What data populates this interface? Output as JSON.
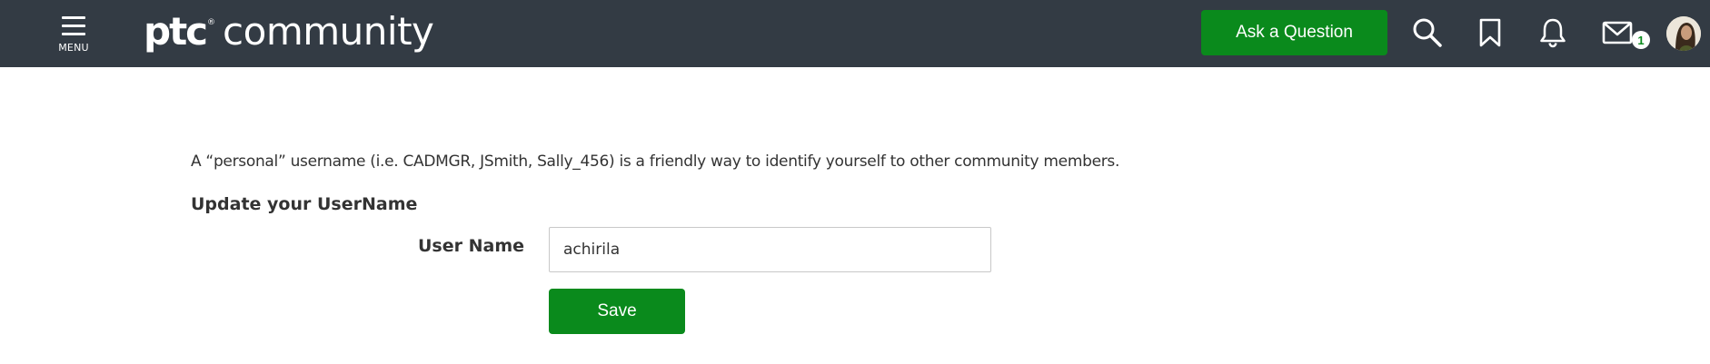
{
  "header": {
    "menu_label": "MENU",
    "logo": {
      "brand": "ptc",
      "registered": "®",
      "product": "community"
    },
    "ask_button_label": "Ask a Question",
    "icons": [
      "hamburger-menu-icon",
      "search-icon",
      "bookmark-icon",
      "bell-icon",
      "envelope-icon"
    ],
    "messages_badge_count": "1",
    "colors": {
      "bar_background": "#333b44",
      "accent_green": "#0a8a1c"
    }
  },
  "main": {
    "intro_text": "A “personal” username (i.e. CADMGR, JSmith, Sally_456) is a friendly way to identify yourself to other community members.",
    "section_heading": "Update your UserName",
    "field_label": "User Name",
    "username_value": "achirila",
    "save_label": "Save"
  }
}
